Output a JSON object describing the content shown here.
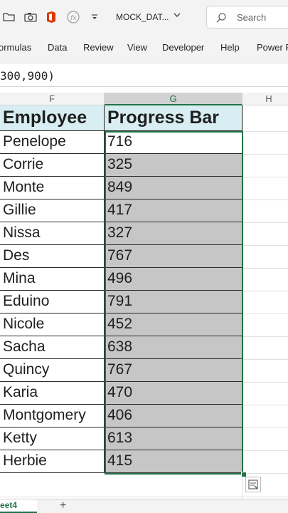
{
  "titlebar": {
    "filename": "MOCK_DAT...",
    "search_placeholder": "Search"
  },
  "ribbon": {
    "tabs": [
      "ormulas",
      "Data",
      "Review",
      "View",
      "Developer",
      "Help",
      "Power P"
    ]
  },
  "formula_bar": {
    "text": "300,900)"
  },
  "columns": {
    "f": "F",
    "g": "G",
    "h": "H"
  },
  "table": {
    "header_employee": "Employee",
    "header_progress": "Progress Bar",
    "rows": [
      {
        "employee": "Penelope",
        "value": "716"
      },
      {
        "employee": "Corrie",
        "value": "325"
      },
      {
        "employee": "Monte",
        "value": "849"
      },
      {
        "employee": "Gillie",
        "value": "417"
      },
      {
        "employee": "Nissa",
        "value": "327"
      },
      {
        "employee": "Des",
        "value": "767"
      },
      {
        "employee": "Mina",
        "value": "496"
      },
      {
        "employee": "Eduino",
        "value": "791"
      },
      {
        "employee": "Nicole",
        "value": "452"
      },
      {
        "employee": "Sacha",
        "value": "638"
      },
      {
        "employee": "Quincy",
        "value": "767"
      },
      {
        "employee": "Karia",
        "value": "470"
      },
      {
        "employee": "Montgomery",
        "value": "406"
      },
      {
        "employee": "Ketty",
        "value": "613"
      },
      {
        "employee": "Herbie",
        "value": "415"
      }
    ]
  },
  "sheets": {
    "active": "eet4",
    "add_label": "+"
  },
  "colors": {
    "accent": "#217346",
    "header_fill": "#d8eef2",
    "selection_fill": "#c6c6c6",
    "office_red": "#d83b01"
  }
}
